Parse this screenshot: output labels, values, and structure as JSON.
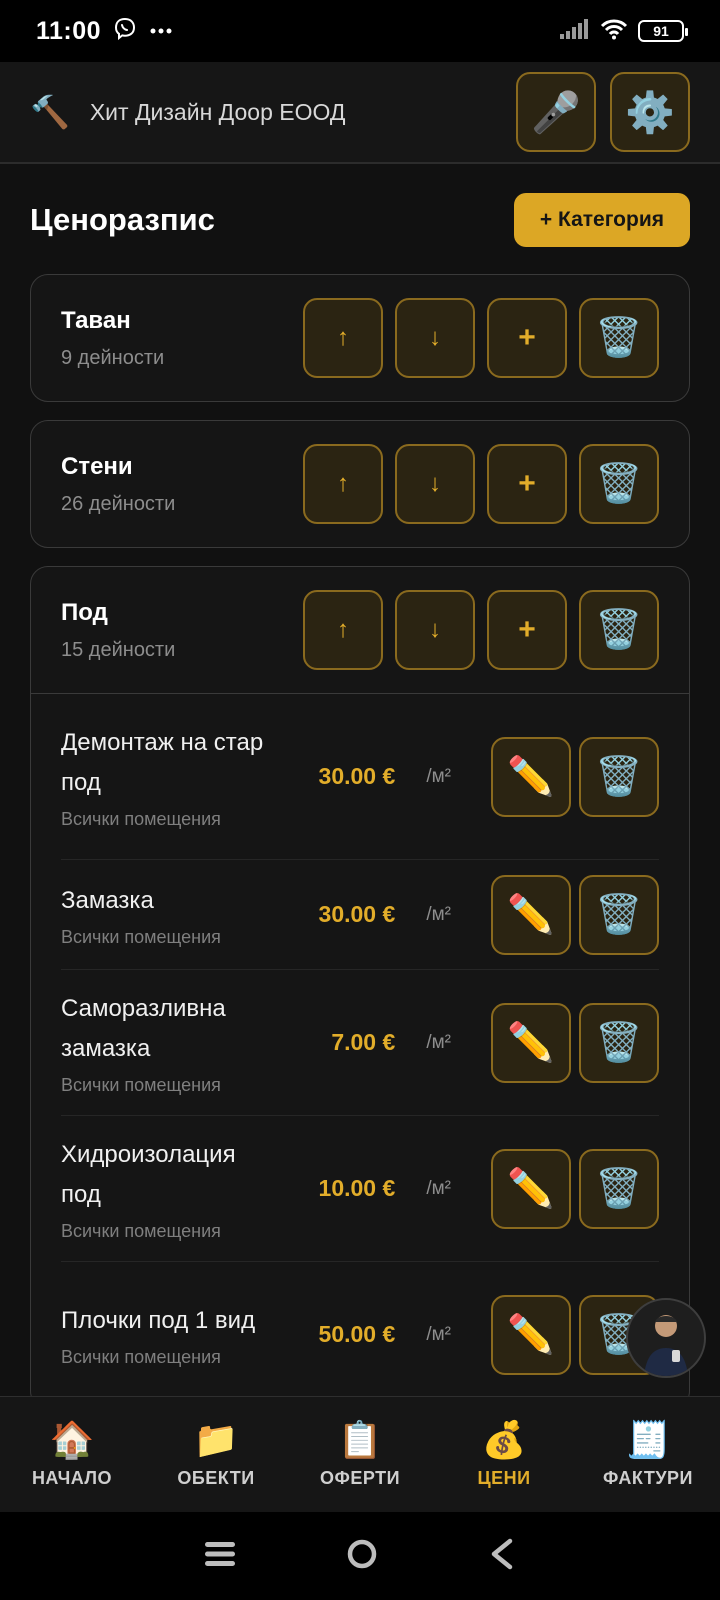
{
  "status": {
    "time": "11:00",
    "battery": "91"
  },
  "header": {
    "company_icon": "🔨",
    "company_name": "Хит Дизайн Доор ЕООД",
    "mic_icon": "🎤",
    "settings_icon": "⚙️"
  },
  "page": {
    "title": "Ценоразпис",
    "add_category_label": "+ Категория"
  },
  "controls": {
    "up": "↑",
    "down": "↓",
    "add": "+",
    "trash": "🗑️",
    "edit": "✏️"
  },
  "categories": [
    {
      "name": "Таван",
      "count": "9 дейности"
    },
    {
      "name": "Стени",
      "count": "26 дейности"
    },
    {
      "name": "Под",
      "count": "15 дейности"
    }
  ],
  "items": [
    {
      "name": "Демонтаж на стар под",
      "scope": "Всички помещения",
      "price": "30.00 €",
      "unit": "/м²"
    },
    {
      "name": "Замазка",
      "scope": "Всички помещения",
      "price": "30.00 €",
      "unit": "/м²"
    },
    {
      "name": "Саморазливна замазка",
      "scope": "Всички помещения",
      "price": "7.00 €",
      "unit": "/м²"
    },
    {
      "name": "Хидроизолация под",
      "scope": "Всички помещения",
      "price": "10.00 €",
      "unit": "/м²"
    },
    {
      "name": "Плочки под 1 вид",
      "scope": "Всички помещения",
      "price": "50.00 €",
      "unit": "/м²"
    }
  ],
  "nav": [
    {
      "icon": "🏠",
      "label": "НАЧАЛО"
    },
    {
      "icon": "📁",
      "label": "ОБЕКТИ"
    },
    {
      "icon": "📋",
      "label": "ОФЕРТИ"
    },
    {
      "icon": "💰",
      "label": "ЦЕНИ"
    },
    {
      "icon": "🧾",
      "label": "ФАКТУРИ"
    }
  ],
  "colors": {
    "accent": "#e2ad2a",
    "background": "#111111",
    "button_border": "#8a6a1e"
  }
}
